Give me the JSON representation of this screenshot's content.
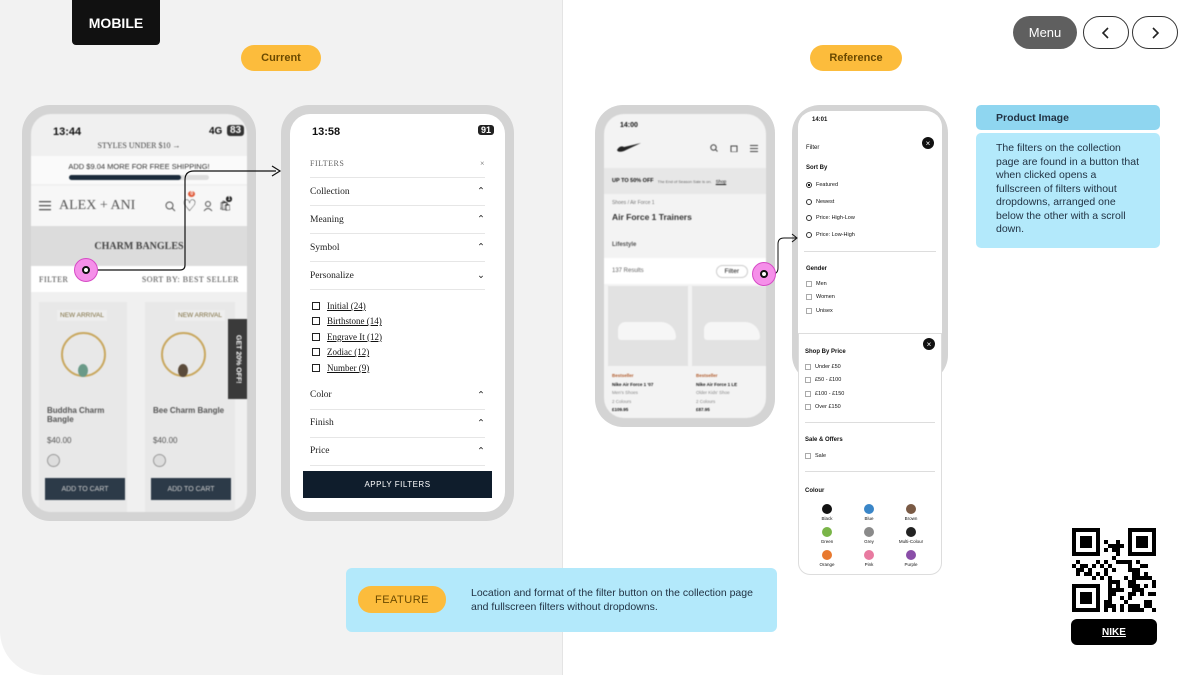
{
  "header": {
    "platform_badge": "MOBILE",
    "current_label": "Current",
    "reference_label": "Reference"
  },
  "nav": {
    "menu_label": "Menu",
    "prev_icon": "chevron-left-icon",
    "next_icon": "chevron-right-icon"
  },
  "colors": {
    "accent": "#fcbc3c",
    "note_bg": "#b3e9fb",
    "note_header": "#8fd6f0",
    "hotspot": "#f58fe9"
  },
  "current_phone1": {
    "time": "13:44",
    "network": "4G",
    "battery": "83",
    "promo_top": "STYLES UNDER $10 →",
    "shipping_banner": "ADD $9.04 MORE FOR FREE SHIPPING!",
    "brand": "ALEX + ANI",
    "wishlist_count": "0",
    "cart_count": "1",
    "category_title": "CHARM BANGLES",
    "filter_label": "FILTER",
    "sort_label": "SORT BY: BEST SELLER",
    "side_tab": "GET 20% OFF!",
    "products": [
      {
        "tag": "NEW ARRIVAL",
        "name": "Buddha Charm Bangle",
        "price": "$40.00",
        "cta": "ADD TO CART"
      },
      {
        "tag": "NEW ARRIVAL",
        "name": "Bee Charm Bangle",
        "price": "$40.00",
        "cta": "ADD TO CART"
      }
    ]
  },
  "current_phone2": {
    "time": "13:58",
    "battery": "91",
    "title": "FILTERS",
    "close": "×",
    "sections": [
      "Collection",
      "Meaning",
      "Symbol",
      "Personalize"
    ],
    "personalize_options": [
      "Initial (24)",
      "Birthstone (14)",
      "Engrave It (12)",
      "Zodiac (12)",
      "Number (9)"
    ],
    "sections_after": [
      "Color",
      "Finish",
      "Price"
    ],
    "apply": "APPLY FILTERS"
  },
  "ref_phone1": {
    "time": "14:00",
    "promo": "UP TO 50% OFF",
    "promo_sub": "The End of Season Sale is on.",
    "promo_link": "Shop",
    "breadcrumb": "Shoes / Air Force 1",
    "title": "Air Force 1 Trainers",
    "subtitle": "Lifestyle",
    "results": "137 Results",
    "filter": "Filter",
    "products": [
      {
        "badge": "Bestseller",
        "name": "Nike Air Force 1 '07",
        "type": "Men's Shoes",
        "colours": "2 Colours",
        "price": "£109.95"
      },
      {
        "badge": "Bestseller",
        "name": "Nike Air Force 1 LE",
        "type": "Older Kids' Shoe",
        "colours": "2 Colours",
        "price": "£87.95"
      }
    ]
  },
  "ref_phone2": {
    "time": "14:01",
    "title": "Filter",
    "sort_title": "Sort By",
    "sort_options": [
      "Featured",
      "Newest",
      "Price: High-Low",
      "Price: Low-High"
    ],
    "gender_title": "Gender",
    "gender_options": [
      "Men",
      "Women",
      "Unisex"
    ],
    "price_title": "Shop By Price",
    "price_options": [
      "Under £50",
      "£50 - £100",
      "£100 - £150",
      "Over £150"
    ],
    "sale_title": "Sale & Offers",
    "sale_options": [
      "Sale"
    ],
    "colour_title": "Colour",
    "colours": [
      {
        "name": "Black",
        "hex": "#111111"
      },
      {
        "name": "Blue",
        "hex": "#3a86c8"
      },
      {
        "name": "Brown",
        "hex": "#7a5a45"
      },
      {
        "name": "Green",
        "hex": "#7ab548"
      },
      {
        "name": "Grey",
        "hex": "#8a8a8a"
      },
      {
        "name": "Multi-Colour",
        "hex": "#222222"
      },
      {
        "name": "Orange",
        "hex": "#e8792f"
      },
      {
        "name": "Pink",
        "hex": "#e87aa0"
      },
      {
        "name": "Purple",
        "hex": "#8a4ea8"
      }
    ]
  },
  "note": {
    "title": "Product Image",
    "body": "The filters on the collection page are found in a button that when clicked opens a fullscreen of filters without dropdowns, arranged one below the other with a scroll down."
  },
  "feature": {
    "tag": "FEATURE",
    "text": "Location and format of the filter button on the collection page and fullscreen filters without dropdowns."
  },
  "brand_tag": "NIKE"
}
